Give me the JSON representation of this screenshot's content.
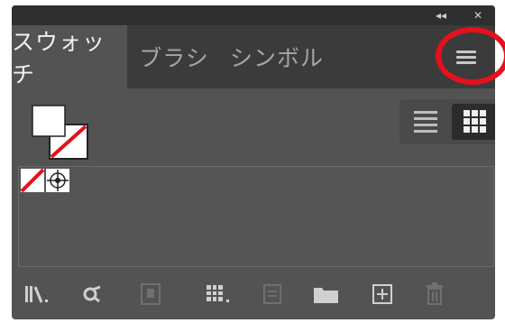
{
  "titlebar": {
    "collapse_glyph": "◂◂",
    "close_glyph": "✕"
  },
  "tabs": [
    {
      "label": "スウォッチ",
      "active": true
    },
    {
      "label": "ブラシ",
      "active": false
    },
    {
      "label": "シンボル",
      "active": false
    }
  ],
  "panel_menu": {
    "icon": "hamburger-menu-icon",
    "highlighted": true,
    "highlight_color": "#e4111c"
  },
  "fill_stroke": {
    "fill": "white",
    "stroke": "none"
  },
  "view_toggle": {
    "list_view": "list-view-icon",
    "thumbnail_view": "thumbnail-view-icon",
    "selected": "thumbnail"
  },
  "swatches": [
    {
      "name": "none-swatch-icon"
    },
    {
      "name": "registration-swatch-icon"
    }
  ],
  "bottom_toolbar": [
    {
      "name": "swatch-libraries-icon",
      "enabled": true
    },
    {
      "name": "swatch-kind-icon",
      "enabled": true
    },
    {
      "name": "add-to-library-icon",
      "enabled": false
    },
    {
      "name": "show-swatch-kinds-icon",
      "enabled": true
    },
    {
      "name": "swatch-options-icon",
      "enabled": false
    },
    {
      "name": "new-color-group-icon",
      "enabled": true
    },
    {
      "name": "new-swatch-icon",
      "enabled": true
    },
    {
      "name": "delete-swatch-icon",
      "enabled": false
    }
  ],
  "colors": {
    "panel": "#535353",
    "tabbar": "#3b3b3b",
    "highlight": "#e4111c",
    "none_slash": "#e4111c"
  }
}
